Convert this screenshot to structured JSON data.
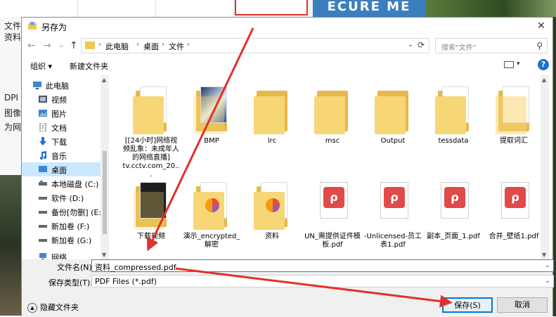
{
  "background": {
    "left_texts": [
      "文件",
      "资料",
      "DPI",
      "图像",
      "为网"
    ],
    "banner_text": "ECURE ME"
  },
  "dialog": {
    "title": "另存为",
    "close_glyph": "✕"
  },
  "nav": {
    "back": "←",
    "forward": "→",
    "dropdown": "⌄",
    "up": "↑",
    "breadcrumbs": [
      "此电脑",
      "桌面",
      "文件"
    ],
    "separator": "›",
    "refresh": "⟳",
    "search_placeholder": "搜索\"文件\"",
    "search_glyph": "⚲"
  },
  "toolbar": {
    "organize": "组织 ▾",
    "new_folder": "新建文件夹",
    "help": "?"
  },
  "sidebar": {
    "items": [
      {
        "label": "此电脑",
        "icon": "computer-icon"
      },
      {
        "label": "视频",
        "icon": "video-icon"
      },
      {
        "label": "图片",
        "icon": "picture-icon"
      },
      {
        "label": "文档",
        "icon": "document-icon"
      },
      {
        "label": "下载",
        "icon": "download-icon"
      },
      {
        "label": "音乐",
        "icon": "music-icon"
      },
      {
        "label": "桌面",
        "icon": "desktop-icon",
        "selected": true
      },
      {
        "label": "本地磁盘 (C:)",
        "icon": "drive-icon"
      },
      {
        "label": "软件 (D:)",
        "icon": "drive-icon"
      },
      {
        "label": "备份[勿删] (E:)",
        "icon": "drive-icon"
      },
      {
        "label": "新加卷 (F:)",
        "icon": "drive-icon"
      },
      {
        "label": "新加卷 (G:)",
        "icon": "drive-icon"
      },
      {
        "label": "网络",
        "icon": "network-icon"
      }
    ]
  },
  "files": [
    {
      "name": "[[24小时]网络视频乱象：未成年人的网络直播] tv.cctv.com_20...",
      "kind": "folder"
    },
    {
      "name": "BMP",
      "kind": "folder-image"
    },
    {
      "name": "lrc",
      "kind": "folder"
    },
    {
      "name": "msc",
      "kind": "folder"
    },
    {
      "name": "Output",
      "kind": "folder"
    },
    {
      "name": "tessdata",
      "kind": "folder"
    },
    {
      "name": "提取词汇",
      "kind": "folder-doc"
    },
    {
      "name": "下载视频",
      "kind": "folder-dark"
    },
    {
      "name": "演示_encrypted_解密",
      "kind": "folder-chart"
    },
    {
      "name": "资料",
      "kind": "folder-chart"
    },
    {
      "name": "UN_需提供证件模板.pdf",
      "kind": "pdf"
    },
    {
      "name": "-Unlicensed-员工表1.pdf",
      "kind": "pdf"
    },
    {
      "name": "副本_页面_1.pdf",
      "kind": "pdf"
    },
    {
      "name": "合并_壁纸1.pdf",
      "kind": "pdf"
    }
  ],
  "fields": {
    "filename_label": "文件名(N):",
    "filename_value": "资料_compressed.pdf",
    "filetype_label": "保存类型(T):",
    "filetype_value": "PDF Files (*.pdf)",
    "dropdown_glyph": "⌄"
  },
  "footer": {
    "hide_folders": "隐藏文件夹",
    "save": "保存(S)",
    "cancel": "取消"
  },
  "colors": {
    "accent": "#0078d7",
    "annotation_red": "#e0312a",
    "selection": "#cce8ff"
  }
}
